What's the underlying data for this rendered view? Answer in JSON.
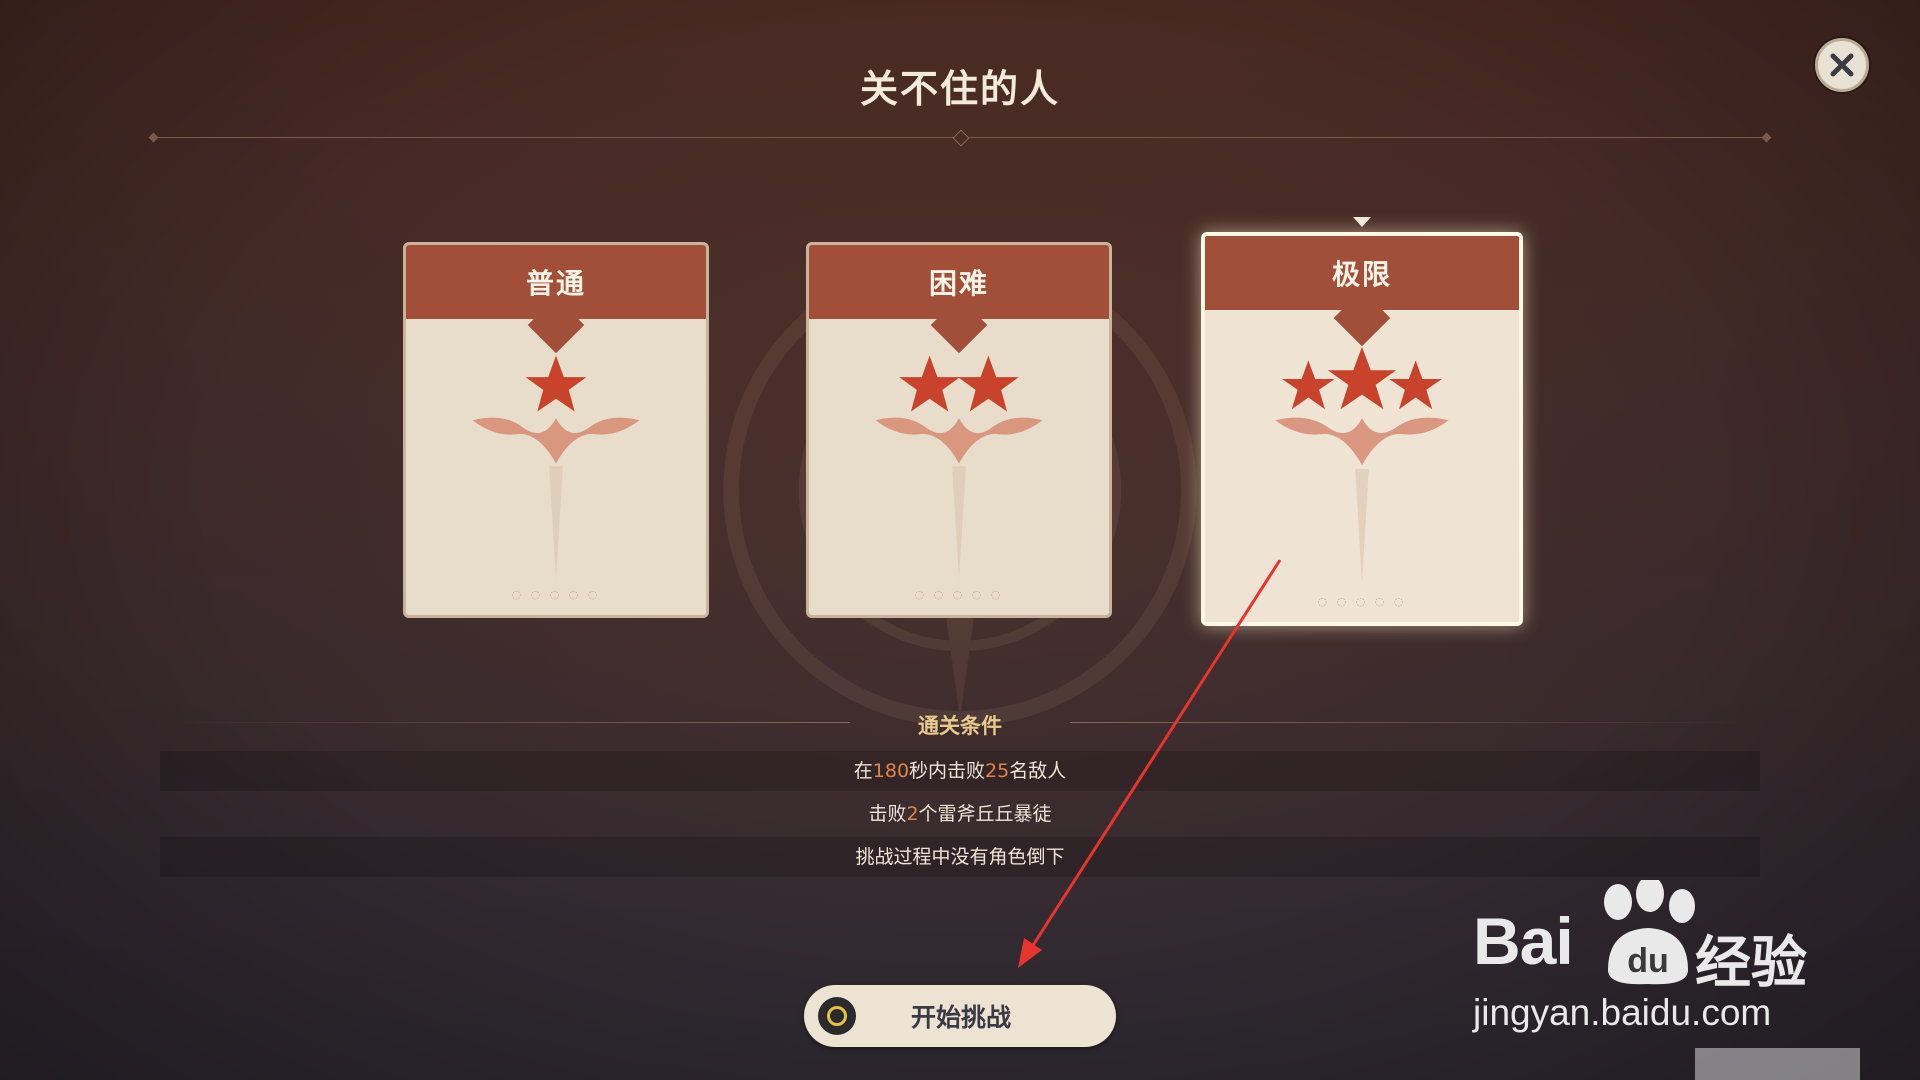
{
  "header": {
    "title": "关不住的人"
  },
  "close_button": {
    "icon": "close-icon"
  },
  "difficulties": [
    {
      "label": "普通",
      "stars": 1,
      "selected": false
    },
    {
      "label": "困难",
      "stars": 2,
      "selected": false
    },
    {
      "label": "极限",
      "stars": 3,
      "selected": true
    }
  ],
  "conditions": {
    "header": "通关条件",
    "row1": {
      "pre": "在",
      "n1": "180",
      "mid": "秒内击败",
      "n2": "25",
      "post": "名敌人"
    },
    "row2": {
      "pre": "击败",
      "n1": "2",
      "post": "个雷斧丘丘暴徒"
    },
    "row3": {
      "text": "挑战过程中没有角色倒下"
    }
  },
  "start_button": {
    "label": "开始挑战",
    "icon": "confirm-circle-icon"
  },
  "watermark": {
    "brand": "Bai",
    "cn": "经验",
    "url": "jingyan.baidu.com"
  },
  "colors": {
    "accent": "#a24f3a",
    "highlight": "#e0844c",
    "header_gold": "#e8c98e",
    "annotation": "#e8332f"
  }
}
